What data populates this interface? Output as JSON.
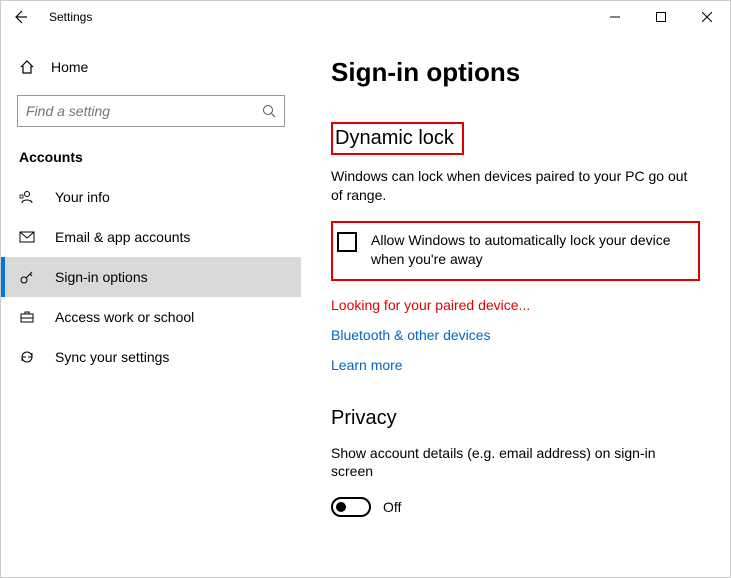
{
  "titlebar": {
    "title": "Settings"
  },
  "sidebar": {
    "home_label": "Home",
    "search_placeholder": "Find a setting",
    "category_label": "Accounts",
    "items": [
      {
        "label": "Your info"
      },
      {
        "label": "Email & app accounts"
      },
      {
        "label": "Sign-in options"
      },
      {
        "label": "Access work or school"
      },
      {
        "label": "Sync your settings"
      }
    ]
  },
  "main": {
    "page_title": "Sign-in options",
    "dynamic_lock": {
      "heading": "Dynamic lock",
      "desc": "Windows can lock when devices paired to your PC go out of range.",
      "checkbox_label": "Allow Windows to automatically lock your device when you're away",
      "looking_text": "Looking for your paired device...",
      "bluetooth_link": "Bluetooth & other devices",
      "learn_more": "Learn more"
    },
    "privacy": {
      "heading": "Privacy",
      "desc": "Show account details (e.g. email address) on sign-in screen",
      "toggle_state": "Off"
    }
  }
}
